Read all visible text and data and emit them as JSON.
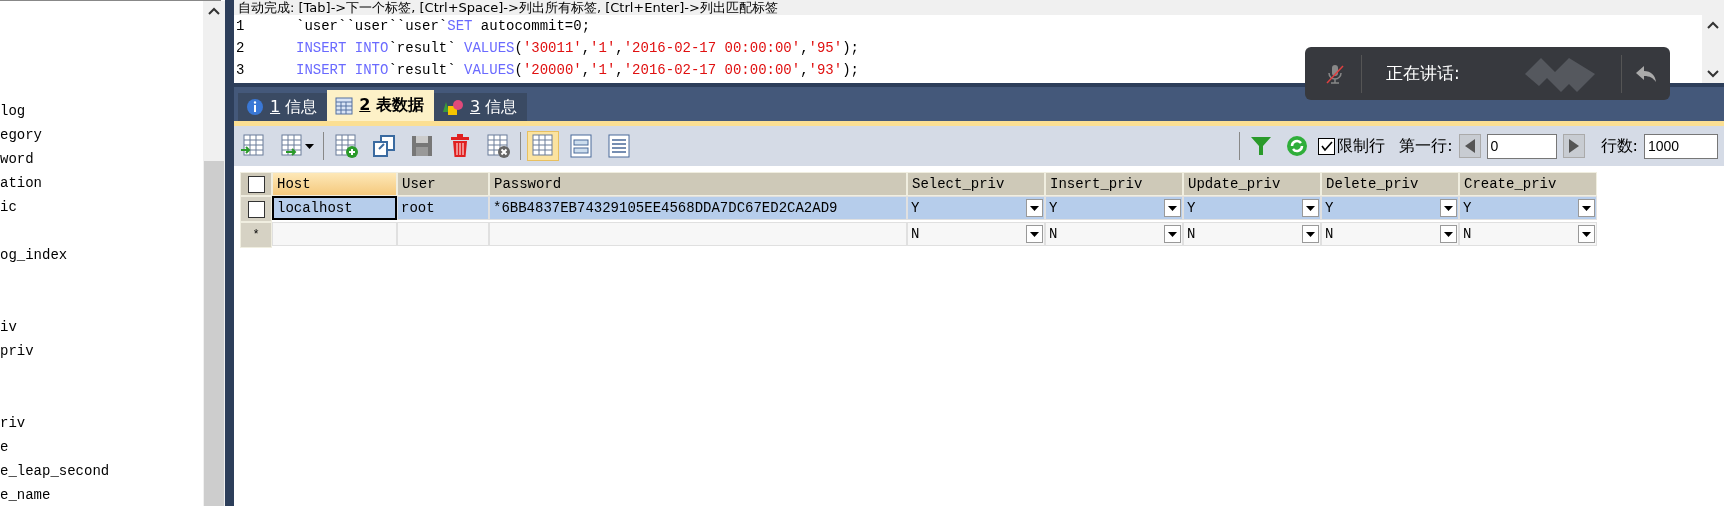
{
  "sidebar": {
    "items": [
      {
        "kind": "table",
        "label": "log"
      },
      {
        "kind": "table",
        "label": "egory"
      },
      {
        "kind": "table",
        "label": "word"
      },
      {
        "kind": "table",
        "label": "ation"
      },
      {
        "kind": "table",
        "label": "ic"
      },
      {
        "kind": "blank"
      },
      {
        "kind": "table",
        "label": "og_index"
      },
      {
        "kind": "blank"
      },
      {
        "kind": "blank"
      },
      {
        "kind": "table",
        "label": "iv"
      },
      {
        "kind": "table",
        "label": "priv"
      },
      {
        "kind": "blank"
      },
      {
        "kind": "blank"
      },
      {
        "kind": "table",
        "label": "riv"
      },
      {
        "kind": "table",
        "label": "e"
      },
      {
        "kind": "table",
        "label": "e_leap_second"
      },
      {
        "kind": "table",
        "label": "e_name"
      }
    ]
  },
  "editor": {
    "hint": "自动完成: [Tab]->下一个标签, [Ctrl+Space]->列出所有标签, [Ctrl+Enter]->列出匹配标签",
    "lines": [
      {
        "number": "1",
        "tokens": [
          {
            "kind": "plain",
            "text": "`user``user``user`"
          },
          {
            "kind": "keyword",
            "text": "SET"
          },
          {
            "kind": "plain",
            "text": " autocommit=0;"
          }
        ]
      },
      {
        "number": "2",
        "tokens": [
          {
            "kind": "keyword",
            "text": "INSERT INTO"
          },
          {
            "kind": "plain",
            "text": "`result` "
          },
          {
            "kind": "keyword",
            "text": "VALUES"
          },
          {
            "kind": "plain",
            "text": "("
          },
          {
            "kind": "string",
            "text": "'30011'"
          },
          {
            "kind": "plain",
            "text": ","
          },
          {
            "kind": "string",
            "text": "'1'"
          },
          {
            "kind": "plain",
            "text": ","
          },
          {
            "kind": "string",
            "text": "'2016-02-17 00:00:00'"
          },
          {
            "kind": "plain",
            "text": ","
          },
          {
            "kind": "string",
            "text": "'95'"
          },
          {
            "kind": "plain",
            "text": ");"
          }
        ]
      },
      {
        "number": "3",
        "tokens": [
          {
            "kind": "keyword",
            "text": "INSERT INTO"
          },
          {
            "kind": "plain",
            "text": "`result` "
          },
          {
            "kind": "keyword",
            "text": "VALUES"
          },
          {
            "kind": "plain",
            "text": "("
          },
          {
            "kind": "string",
            "text": "'20000'"
          },
          {
            "kind": "plain",
            "text": ","
          },
          {
            "kind": "string",
            "text": "'1'"
          },
          {
            "kind": "plain",
            "text": ","
          },
          {
            "kind": "string",
            "text": "'2016-02-17 00:00:00'"
          },
          {
            "kind": "plain",
            "text": ","
          },
          {
            "kind": "string",
            "text": "'93'"
          },
          {
            "kind": "plain",
            "text": ");"
          }
        ]
      }
    ]
  },
  "tabs": [
    {
      "number": "1",
      "label": "信息",
      "kind": "info",
      "selected": false
    },
    {
      "number": "2",
      "label": "表数据",
      "kind": "data",
      "selected": true
    },
    {
      "number": "3",
      "label": "信息",
      "kind": "profile",
      "selected": false
    }
  ],
  "toolbar": {
    "view_modes": [
      {
        "kind": "grid",
        "selected": true
      },
      {
        "kind": "form",
        "selected": false
      },
      {
        "kind": "text",
        "selected": false
      }
    ],
    "limit_rows": {
      "label": "限制行",
      "checked": true
    },
    "first_row": {
      "label": "第一行:",
      "value": "0"
    },
    "row_count": {
      "label": "行数:",
      "value": "1000"
    }
  },
  "table": {
    "select_all": {
      "checked": false
    },
    "columns": [
      {
        "label": "Host",
        "kind": "text",
        "selected": true
      },
      {
        "label": "User",
        "kind": "text",
        "selected": false
      },
      {
        "label": "Password",
        "kind": "text",
        "selected": false
      },
      {
        "label": "Select_priv",
        "kind": "enum",
        "selected": false
      },
      {
        "label": "Insert_priv",
        "kind": "enum",
        "selected": false
      },
      {
        "label": "Update_priv",
        "kind": "enum",
        "selected": false
      },
      {
        "label": "Delete_priv",
        "kind": "enum",
        "selected": false
      },
      {
        "label": "Create_priv",
        "kind": "enum",
        "selected": false
      }
    ],
    "rows": [
      {
        "kind": "record",
        "selected": true,
        "checked": false,
        "cells": [
          {
            "text": "localhost",
            "focused": true
          },
          {
            "text": "root",
            "focused": false
          },
          {
            "text": "*6BB4837EB74329105EE4568DDA7DC67ED2CA2AD9",
            "focused": false
          },
          {
            "text": "Y",
            "focused": false
          },
          {
            "text": "Y",
            "focused": false
          },
          {
            "text": "Y",
            "focused": false
          },
          {
            "text": "Y",
            "focused": false
          },
          {
            "text": "Y",
            "focused": false
          }
        ]
      },
      {
        "kind": "new",
        "marker": "*",
        "selected": false,
        "cells": [
          {
            "text": "",
            "focused": false
          },
          {
            "text": "",
            "focused": false
          },
          {
            "text": "",
            "focused": false
          },
          {
            "text": "N",
            "focused": false
          },
          {
            "text": "N",
            "focused": false
          },
          {
            "text": "N",
            "focused": false
          },
          {
            "text": "N",
            "focused": false
          },
          {
            "text": "N",
            "focused": false
          }
        ]
      }
    ]
  },
  "overlay": {
    "text": "正在讲话:"
  }
}
